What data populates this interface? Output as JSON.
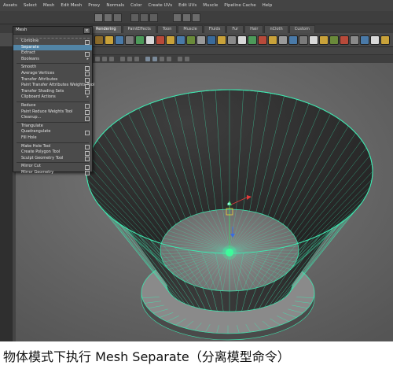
{
  "menubar": {
    "items": [
      "Assets",
      "Select",
      "Mesh",
      "Edit Mesh",
      "Proxy",
      "Normals",
      "Color",
      "Create UVs",
      "Edit UVs",
      "Muscle",
      "Pipeline Cache",
      "Help"
    ]
  },
  "shelf": {
    "tabs": [
      "Rendering",
      "PaintEffects",
      "Toon",
      "Muscle",
      "Fluids",
      "Fur",
      "Hair",
      "nCloth",
      "Custom"
    ],
    "active_tab": "Rendering"
  },
  "viewport_menu": {
    "items": [
      "Panels"
    ]
  },
  "mesh_menu": {
    "title": "Mesh",
    "items": [
      {
        "label": "Combine",
        "option": true
      },
      {
        "label": "Separate",
        "option": false,
        "highlighted": true
      },
      {
        "label": "Extract",
        "option": true
      },
      {
        "label": "Booleans",
        "submenu": true
      },
      {
        "label": "Smooth",
        "option": true
      },
      {
        "label": "Average Vertices",
        "option": true
      },
      {
        "label": "Transfer Attributes",
        "option": true
      },
      {
        "label": "Paint Transfer Attributes Weights Tool",
        "option": true
      },
      {
        "label": "Transfer Shading Sets",
        "option": true
      },
      {
        "label": "Clipboard Actions",
        "submenu": true
      },
      {
        "label": "Reduce",
        "option": true
      },
      {
        "label": "Paint Reduce Weights Tool",
        "option": true
      },
      {
        "label": "Cleanup...",
        "option": true
      },
      {
        "label": "Triangulate",
        "option": false
      },
      {
        "label": "Quadrangulate",
        "option": true
      },
      {
        "label": "Fill Hole",
        "option": false
      },
      {
        "label": "Make Hole Tool",
        "option": true
      },
      {
        "label": "Create Polygon Tool",
        "option": true
      },
      {
        "label": "Sculpt Geometry Tool",
        "option": true
      },
      {
        "label": "Mirror Cut",
        "option": true
      },
      {
        "label": "Mirror Geometry",
        "option": true
      }
    ]
  },
  "caption": {
    "text": "物体模式下执行 Mesh      Separate（分离模型命令）"
  },
  "colors": {
    "wireframe": "#3ee8b0",
    "manipulator_center": "#3cff9a",
    "menu_highlight": "#5285a6",
    "background": "#3c3c3c"
  }
}
